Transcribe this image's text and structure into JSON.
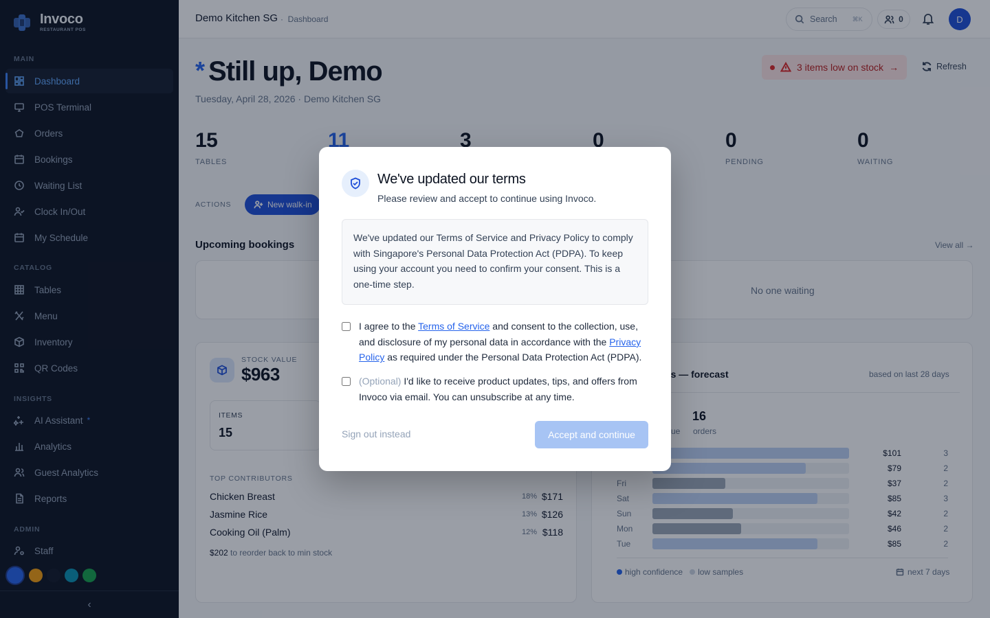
{
  "brand": {
    "name": "Invoco",
    "subtitle": "RESTAURANT POS"
  },
  "sidebar": {
    "sections": [
      {
        "label": "MAIN",
        "items": [
          {
            "label": "Dashboard",
            "icon": "dashboard-icon",
            "active": true
          },
          {
            "label": "POS Terminal",
            "icon": "monitor-icon"
          },
          {
            "label": "Orders",
            "icon": "orders-icon"
          },
          {
            "label": "Bookings",
            "icon": "calendar-icon"
          },
          {
            "label": "Waiting List",
            "icon": "clock-icon"
          },
          {
            "label": "Clock In/Out",
            "icon": "user-check-icon"
          },
          {
            "label": "My Schedule",
            "icon": "calendar-icon"
          }
        ]
      },
      {
        "label": "CATALOG",
        "items": [
          {
            "label": "Tables",
            "icon": "grid-icon"
          },
          {
            "label": "Menu",
            "icon": "utensils-icon"
          },
          {
            "label": "Inventory",
            "icon": "box-icon"
          },
          {
            "label": "QR Codes",
            "icon": "qr-icon"
          }
        ]
      },
      {
        "label": "INSIGHTS",
        "items": [
          {
            "label": "AI Assistant",
            "icon": "sparkles-icon",
            "badge": "*"
          },
          {
            "label": "Analytics",
            "icon": "bar-chart-icon"
          },
          {
            "label": "Guest Analytics",
            "icon": "users-icon"
          },
          {
            "label": "Reports",
            "icon": "file-icon"
          }
        ]
      },
      {
        "label": "ADMIN",
        "items": [
          {
            "label": "Staff",
            "icon": "user-cog-icon"
          }
        ]
      }
    ],
    "theme_swatches": [
      "#2563eb",
      "#f59e0b",
      "#111827",
      "#0891b2",
      "#16a34a"
    ],
    "collapse_icon": "chevron-left-icon",
    "collapse_glyph": "‹"
  },
  "topbar": {
    "org_name": "Demo Kitchen SG",
    "separator": "·",
    "breadcrumb": "Dashboard",
    "search_label": "Search",
    "search_shortcut": "⌘K",
    "online_users": "0",
    "avatar_initial": "D"
  },
  "main": {
    "greeting_star": "*",
    "greeting": "Still up, Demo",
    "date_line": "Tuesday, April 28, 2026 · Demo Kitchen SG",
    "alert": {
      "text": "3 items low on stock",
      "arrow": "→"
    },
    "refresh_label": "Refresh",
    "stats": [
      {
        "value": "15",
        "label": "TABLES",
        "color": "#0b1220"
      },
      {
        "value": "11",
        "label": "",
        "color": "#2563eb"
      },
      {
        "value": "3",
        "label": "",
        "color": "#0b1220"
      },
      {
        "value": "0",
        "label": "",
        "color": "#0b1220"
      },
      {
        "value": "0",
        "label": "PENDING",
        "color": "#0b1220"
      },
      {
        "value": "0",
        "label": "WAITING",
        "color": "#0b1220"
      }
    ],
    "actions_label": "ACTIONS",
    "walkin_label": "New walk-in",
    "upcoming_title": "Upcoming bookings",
    "view_all": "View all →",
    "waiting_empty": "No one waiting",
    "stock": {
      "label": "STOCK VALUE",
      "value": "$963",
      "items_label": "ITEMS",
      "items_value": "15",
      "contributors_title": "TOP CONTRIBUTORS",
      "contributors": [
        {
          "name": "Chicken Breast",
          "pct": "18%",
          "amount": "$171"
        },
        {
          "name": "Jasmine Rice",
          "pct": "13%",
          "amount": "$126"
        },
        {
          "name": "Cooking Oil (Palm)",
          "pct": "12%",
          "amount": "$118"
        }
      ],
      "reorder_amount": "$202",
      "reorder_text": " to reorder back to min stock"
    },
    "forecast": {
      "title": "ays — forecast",
      "basis": "based on last 28 days",
      "kpi_revenue_label": "ue",
      "kpi_orders_value": "16",
      "kpi_orders_label": "orders",
      "rows": [
        {
          "day": "",
          "amount": "$101",
          "count": "3",
          "fraction": 1.0,
          "confident": true
        },
        {
          "day": "",
          "amount": "$79",
          "count": "2",
          "fraction": 0.78,
          "confident": true
        },
        {
          "day": "Fri",
          "amount": "$37",
          "count": "2",
          "fraction": 0.37,
          "confident": false
        },
        {
          "day": "Sat",
          "amount": "$85",
          "count": "3",
          "fraction": 0.84,
          "confident": true
        },
        {
          "day": "Sun",
          "amount": "$42",
          "count": "2",
          "fraction": 0.41,
          "confident": false
        },
        {
          "day": "Mon",
          "amount": "$46",
          "count": "2",
          "fraction": 0.45,
          "confident": false
        },
        {
          "day": "Tue",
          "amount": "$85",
          "count": "2",
          "fraction": 0.84,
          "confident": true
        }
      ],
      "legend_high": "high confidence",
      "legend_low": "low samples",
      "next_label": "next 7 days",
      "colors": {
        "high": "#bcd0f3",
        "low": "#9aa5b5",
        "high_dot": "#2563eb",
        "low_dot": "#cbd5e1"
      }
    }
  },
  "modal": {
    "title": "We've updated our terms",
    "subtitle": "Please review and accept to continue using Invoco.",
    "notice": "We've updated our Terms of Service and Privacy Policy to comply with Singapore's Personal Data Protection Act (PDPA). To keep using your account you need to confirm your consent. This is a one-time step.",
    "consent1": {
      "pre": "I agree to the ",
      "link1": "Terms of Service",
      "mid": " and consent to the collection, use, and disclosure of my personal data in accordance with the ",
      "link2": "Privacy Policy",
      "post": " as required under the Personal Data Protection Act (PDPA).",
      "checked": false
    },
    "consent2": {
      "optional": "(Optional)",
      "text": " I'd like to receive product updates, tips, and offers from Invoco via email. You can unsubscribe at any time.",
      "checked": false
    },
    "signout_label": "Sign out instead",
    "accept_label": "Accept and continue"
  }
}
